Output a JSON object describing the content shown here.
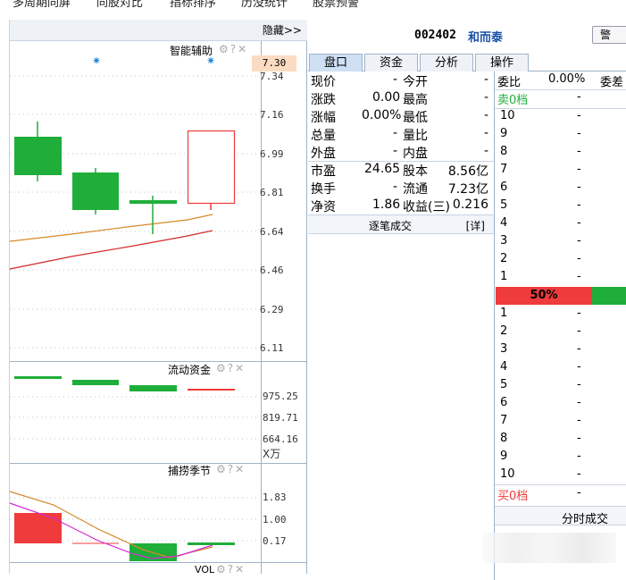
{
  "topnav": [
    "多周期同屏",
    "同股对比",
    "指标排序",
    "历没统计",
    "股票预警"
  ],
  "left": {
    "hide_label": "隐藏>>",
    "main_panel": {
      "title": "智能辅助",
      "icons": [
        "gear-icon",
        "help-icon",
        "close-icon"
      ],
      "price_marker": "7.30",
      "axis_labels": [
        "7.34",
        "7.16",
        "6.99",
        "6.81",
        "6.64",
        "6.46",
        "6.29",
        "6.11"
      ]
    },
    "flow_panel": {
      "title": "流动资金",
      "axis_labels": [
        "975.25",
        "819.71",
        "664.16"
      ],
      "unit": "X万"
    },
    "season_panel": {
      "title": "捕捞季节",
      "axis_labels": [
        "1.83",
        "1.00",
        "0.17"
      ]
    },
    "vol_panel": {
      "title": "VOL"
    }
  },
  "quote": {
    "code": "002402",
    "name": "和而泰",
    "warn_button": "警",
    "tabs": [
      "盘口",
      "资金",
      "分析",
      "操作"
    ],
    "rows": [
      [
        "现价",
        "-",
        "今开",
        "-"
      ],
      [
        "涨跌",
        "0.00",
        "最高",
        "-"
      ],
      [
        "涨幅",
        "0.00%",
        "最低",
        "-"
      ],
      [
        "总量",
        "-",
        "量比",
        "-"
      ],
      [
        "外盘",
        "-",
        "内盘",
        "-"
      ],
      [
        "市盈",
        "24.65",
        "股本",
        "8.56亿"
      ],
      [
        "换手",
        "-",
        "流通",
        "7.23亿"
      ],
      [
        "净资",
        "1.86",
        "收益(三)",
        "0.216"
      ]
    ],
    "deal_label": "逐笔成交",
    "detail_label": "[详]"
  },
  "orderbook": {
    "ratio_label": "委比",
    "ratio_value": "0.00%",
    "ratio_label2": "委差",
    "sell_label": "卖0档",
    "sell_levels": [
      "10",
      "9",
      "8",
      "7",
      "6",
      "5",
      "4",
      "3",
      "2",
      "1"
    ],
    "buy_levels": [
      "1",
      "2",
      "3",
      "4",
      "5",
      "6",
      "7",
      "8",
      "9",
      "10"
    ],
    "empty_value": "-",
    "bar_percent": "50%",
    "buy_label": "买0档",
    "fenshi_label": "分时成交"
  },
  "colors": {
    "up": "#ef3b3b",
    "down": "#1fae3a",
    "label_blue": "#1a4fa3",
    "ma_orange": "#d4892a",
    "ma_red": "#d42a2a",
    "magenta": "#d42ad4"
  }
}
